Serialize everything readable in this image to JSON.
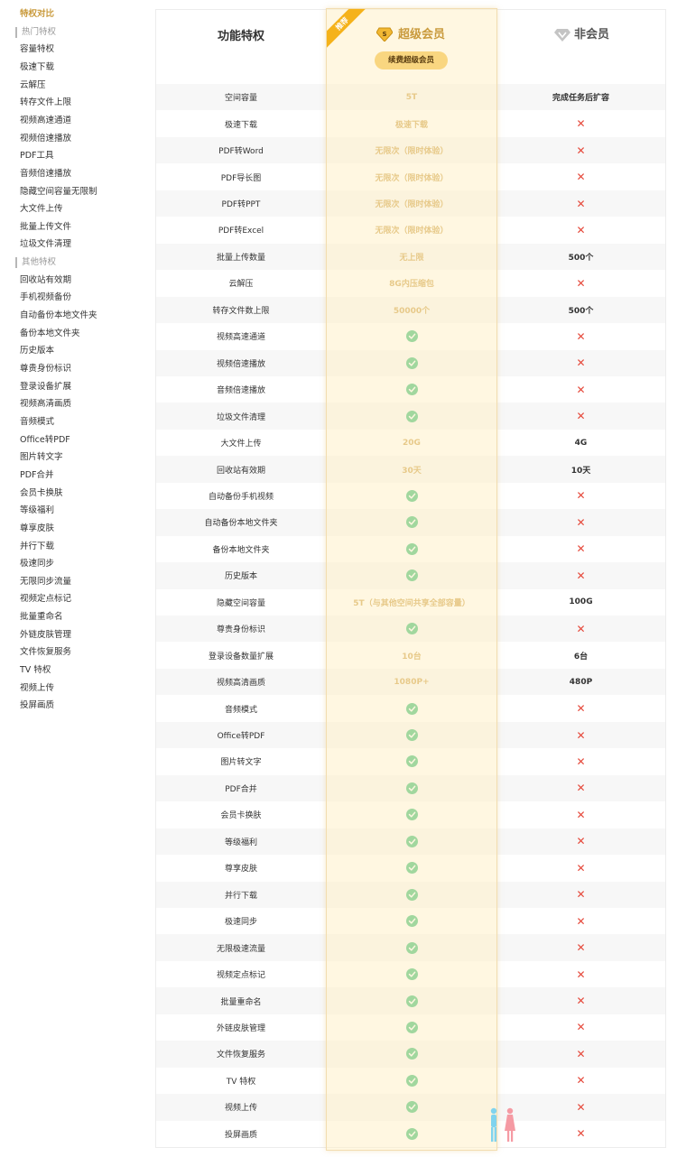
{
  "sidebar": {
    "items": [
      {
        "label": "特权对比",
        "type": "active"
      },
      {
        "label": "热门特权",
        "type": "group"
      },
      {
        "label": "容量特权",
        "type": "item"
      },
      {
        "label": "极速下载",
        "type": "item"
      },
      {
        "label": "云解压",
        "type": "item"
      },
      {
        "label": "转存文件上限",
        "type": "item"
      },
      {
        "label": "视频高速通道",
        "type": "item"
      },
      {
        "label": "视频倍速播放",
        "type": "item"
      },
      {
        "label": "PDF工具",
        "type": "item"
      },
      {
        "label": "音频倍速播放",
        "type": "item"
      },
      {
        "label": "隐藏空间容量无限制",
        "type": "item"
      },
      {
        "label": "大文件上传",
        "type": "item"
      },
      {
        "label": "批量上传文件",
        "type": "item"
      },
      {
        "label": "垃圾文件清理",
        "type": "item"
      },
      {
        "label": "其他特权",
        "type": "group"
      },
      {
        "label": "回收站有效期",
        "type": "item"
      },
      {
        "label": "手机视频备份",
        "type": "item"
      },
      {
        "label": "自动备份本地文件夹",
        "type": "item"
      },
      {
        "label": "备份本地文件夹",
        "type": "item"
      },
      {
        "label": "历史版本",
        "type": "item"
      },
      {
        "label": "尊贵身份标识",
        "type": "item"
      },
      {
        "label": "登录设备扩展",
        "type": "item"
      },
      {
        "label": "视频高清画质",
        "type": "item"
      },
      {
        "label": "音频模式",
        "type": "item"
      },
      {
        "label": "Office转PDF",
        "type": "item"
      },
      {
        "label": "图片转文字",
        "type": "item"
      },
      {
        "label": "PDF合并",
        "type": "item"
      },
      {
        "label": "会员卡换肤",
        "type": "item"
      },
      {
        "label": "等级福利",
        "type": "item"
      },
      {
        "label": "尊享皮肤",
        "type": "item"
      },
      {
        "label": "并行下载",
        "type": "item"
      },
      {
        "label": "极速同步",
        "type": "item"
      },
      {
        "label": "无限同步流量",
        "type": "item"
      },
      {
        "label": "视频定点标记",
        "type": "item"
      },
      {
        "label": "批量重命名",
        "type": "item"
      },
      {
        "label": "外链皮肤管理",
        "type": "item"
      },
      {
        "label": "文件恢复服务",
        "type": "item"
      },
      {
        "label": "TV 特权",
        "type": "item"
      },
      {
        "label": "视频上传",
        "type": "item"
      },
      {
        "label": "投屏画质",
        "type": "item"
      }
    ]
  },
  "header": {
    "feature_col": "功能特权",
    "vip_col": "超级会员",
    "non_col": "非会员",
    "ribbon": "推荐",
    "renew_button": "续费超级会员",
    "vip_icon": "gold-diamond-s-icon",
    "non_icon": "gray-diamond-icon"
  },
  "colors": {
    "accent_gold": "#c99a3c",
    "button_bg": "#f9d680",
    "ribbon": "#f5b21a",
    "check": "#2fb96a",
    "cross": "#e5483a"
  },
  "rows": [
    {
      "feature": "空间容量",
      "vip": "5T",
      "non": "完成任务后扩容"
    },
    {
      "feature": "极速下载",
      "vip": "极速下载",
      "non": "cross"
    },
    {
      "feature": "PDF转Word",
      "vip": "无限次（限时体验）",
      "non": "cross"
    },
    {
      "feature": "PDF导长图",
      "vip": "无限次（限时体验）",
      "non": "cross"
    },
    {
      "feature": "PDF转PPT",
      "vip": "无限次（限时体验）",
      "non": "cross"
    },
    {
      "feature": "PDF转Excel",
      "vip": "无限次（限时体验）",
      "non": "cross"
    },
    {
      "feature": "批量上传数量",
      "vip": "无上限",
      "non": "500个"
    },
    {
      "feature": "云解压",
      "vip": "8G内压缩包",
      "non": "cross"
    },
    {
      "feature": "转存文件数上限",
      "vip": "50000个",
      "non": "500个"
    },
    {
      "feature": "视频高速通道",
      "vip": "check",
      "non": "cross"
    },
    {
      "feature": "视频倍速播放",
      "vip": "check",
      "non": "cross"
    },
    {
      "feature": "音频倍速播放",
      "vip": "check",
      "non": "cross"
    },
    {
      "feature": "垃圾文件清理",
      "vip": "check",
      "non": "cross"
    },
    {
      "feature": "大文件上传",
      "vip": "20G",
      "non": "4G"
    },
    {
      "feature": "回收站有效期",
      "vip": "30天",
      "non": "10天"
    },
    {
      "feature": "自动备份手机视频",
      "vip": "check",
      "non": "cross"
    },
    {
      "feature": "自动备份本地文件夹",
      "vip": "check",
      "non": "cross"
    },
    {
      "feature": "备份本地文件夹",
      "vip": "check",
      "non": "cross"
    },
    {
      "feature": "历史版本",
      "vip": "check",
      "non": "cross"
    },
    {
      "feature": "隐藏空间容量",
      "vip": "5T（与其他空间共享全部容量）",
      "non": "100G"
    },
    {
      "feature": "尊贵身份标识",
      "vip": "check",
      "non": "cross"
    },
    {
      "feature": "登录设备数量扩展",
      "vip": "10台",
      "non": "6台"
    },
    {
      "feature": "视频高清画质",
      "vip": "1080P+",
      "non": "480P"
    },
    {
      "feature": "音频模式",
      "vip": "check",
      "non": "cross"
    },
    {
      "feature": "Office转PDF",
      "vip": "check",
      "non": "cross"
    },
    {
      "feature": "图片转文字",
      "vip": "check",
      "non": "cross"
    },
    {
      "feature": "PDF合并",
      "vip": "check",
      "non": "cross"
    },
    {
      "feature": "会员卡换肤",
      "vip": "check",
      "non": "cross"
    },
    {
      "feature": "等级福利",
      "vip": "check",
      "non": "cross"
    },
    {
      "feature": "尊享皮肤",
      "vip": "check",
      "non": "cross"
    },
    {
      "feature": "并行下载",
      "vip": "check",
      "non": "cross"
    },
    {
      "feature": "极速同步",
      "vip": "check",
      "non": "cross"
    },
    {
      "feature": "无限极速流量",
      "vip": "check",
      "non": "cross"
    },
    {
      "feature": "视频定点标记",
      "vip": "check",
      "non": "cross"
    },
    {
      "feature": "批量重命名",
      "vip": "check",
      "non": "cross"
    },
    {
      "feature": "外链皮肤管理",
      "vip": "check",
      "non": "cross"
    },
    {
      "feature": "文件恢复服务",
      "vip": "check",
      "non": "cross"
    },
    {
      "feature": "TV 特权",
      "vip": "check",
      "non": "cross"
    },
    {
      "feature": "视频上传",
      "vip": "check",
      "non": "cross"
    },
    {
      "feature": "投屏画质",
      "vip": "check",
      "non": "cross"
    }
  ]
}
